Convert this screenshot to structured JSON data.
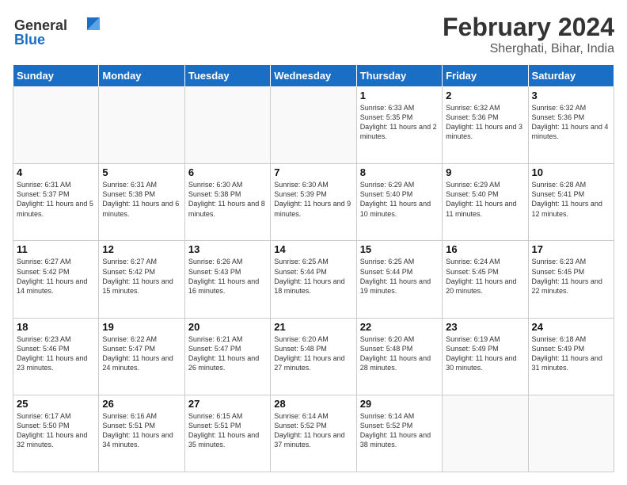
{
  "logo": {
    "line1": "General",
    "line2": "Blue"
  },
  "title": "February 2024",
  "subtitle": "Sherghati, Bihar, India",
  "days_of_week": [
    "Sunday",
    "Monday",
    "Tuesday",
    "Wednesday",
    "Thursday",
    "Friday",
    "Saturday"
  ],
  "weeks": [
    [
      {
        "day": "",
        "info": ""
      },
      {
        "day": "",
        "info": ""
      },
      {
        "day": "",
        "info": ""
      },
      {
        "day": "",
        "info": ""
      },
      {
        "day": "1",
        "info": "Sunrise: 6:33 AM\nSunset: 5:35 PM\nDaylight: 11 hours and 2 minutes."
      },
      {
        "day": "2",
        "info": "Sunrise: 6:32 AM\nSunset: 5:36 PM\nDaylight: 11 hours and 3 minutes."
      },
      {
        "day": "3",
        "info": "Sunrise: 6:32 AM\nSunset: 5:36 PM\nDaylight: 11 hours and 4 minutes."
      }
    ],
    [
      {
        "day": "4",
        "info": "Sunrise: 6:31 AM\nSunset: 5:37 PM\nDaylight: 11 hours and 5 minutes."
      },
      {
        "day": "5",
        "info": "Sunrise: 6:31 AM\nSunset: 5:38 PM\nDaylight: 11 hours and 6 minutes."
      },
      {
        "day": "6",
        "info": "Sunrise: 6:30 AM\nSunset: 5:38 PM\nDaylight: 11 hours and 8 minutes."
      },
      {
        "day": "7",
        "info": "Sunrise: 6:30 AM\nSunset: 5:39 PM\nDaylight: 11 hours and 9 minutes."
      },
      {
        "day": "8",
        "info": "Sunrise: 6:29 AM\nSunset: 5:40 PM\nDaylight: 11 hours and 10 minutes."
      },
      {
        "day": "9",
        "info": "Sunrise: 6:29 AM\nSunset: 5:40 PM\nDaylight: 11 hours and 11 minutes."
      },
      {
        "day": "10",
        "info": "Sunrise: 6:28 AM\nSunset: 5:41 PM\nDaylight: 11 hours and 12 minutes."
      }
    ],
    [
      {
        "day": "11",
        "info": "Sunrise: 6:27 AM\nSunset: 5:42 PM\nDaylight: 11 hours and 14 minutes."
      },
      {
        "day": "12",
        "info": "Sunrise: 6:27 AM\nSunset: 5:42 PM\nDaylight: 11 hours and 15 minutes."
      },
      {
        "day": "13",
        "info": "Sunrise: 6:26 AM\nSunset: 5:43 PM\nDaylight: 11 hours and 16 minutes."
      },
      {
        "day": "14",
        "info": "Sunrise: 6:25 AM\nSunset: 5:44 PM\nDaylight: 11 hours and 18 minutes."
      },
      {
        "day": "15",
        "info": "Sunrise: 6:25 AM\nSunset: 5:44 PM\nDaylight: 11 hours and 19 minutes."
      },
      {
        "day": "16",
        "info": "Sunrise: 6:24 AM\nSunset: 5:45 PM\nDaylight: 11 hours and 20 minutes."
      },
      {
        "day": "17",
        "info": "Sunrise: 6:23 AM\nSunset: 5:45 PM\nDaylight: 11 hours and 22 minutes."
      }
    ],
    [
      {
        "day": "18",
        "info": "Sunrise: 6:23 AM\nSunset: 5:46 PM\nDaylight: 11 hours and 23 minutes."
      },
      {
        "day": "19",
        "info": "Sunrise: 6:22 AM\nSunset: 5:47 PM\nDaylight: 11 hours and 24 minutes."
      },
      {
        "day": "20",
        "info": "Sunrise: 6:21 AM\nSunset: 5:47 PM\nDaylight: 11 hours and 26 minutes."
      },
      {
        "day": "21",
        "info": "Sunrise: 6:20 AM\nSunset: 5:48 PM\nDaylight: 11 hours and 27 minutes."
      },
      {
        "day": "22",
        "info": "Sunrise: 6:20 AM\nSunset: 5:48 PM\nDaylight: 11 hours and 28 minutes."
      },
      {
        "day": "23",
        "info": "Sunrise: 6:19 AM\nSunset: 5:49 PM\nDaylight: 11 hours and 30 minutes."
      },
      {
        "day": "24",
        "info": "Sunrise: 6:18 AM\nSunset: 5:49 PM\nDaylight: 11 hours and 31 minutes."
      }
    ],
    [
      {
        "day": "25",
        "info": "Sunrise: 6:17 AM\nSunset: 5:50 PM\nDaylight: 11 hours and 32 minutes."
      },
      {
        "day": "26",
        "info": "Sunrise: 6:16 AM\nSunset: 5:51 PM\nDaylight: 11 hours and 34 minutes."
      },
      {
        "day": "27",
        "info": "Sunrise: 6:15 AM\nSunset: 5:51 PM\nDaylight: 11 hours and 35 minutes."
      },
      {
        "day": "28",
        "info": "Sunrise: 6:14 AM\nSunset: 5:52 PM\nDaylight: 11 hours and 37 minutes."
      },
      {
        "day": "29",
        "info": "Sunrise: 6:14 AM\nSunset: 5:52 PM\nDaylight: 11 hours and 38 minutes."
      },
      {
        "day": "",
        "info": ""
      },
      {
        "day": "",
        "info": ""
      }
    ]
  ]
}
